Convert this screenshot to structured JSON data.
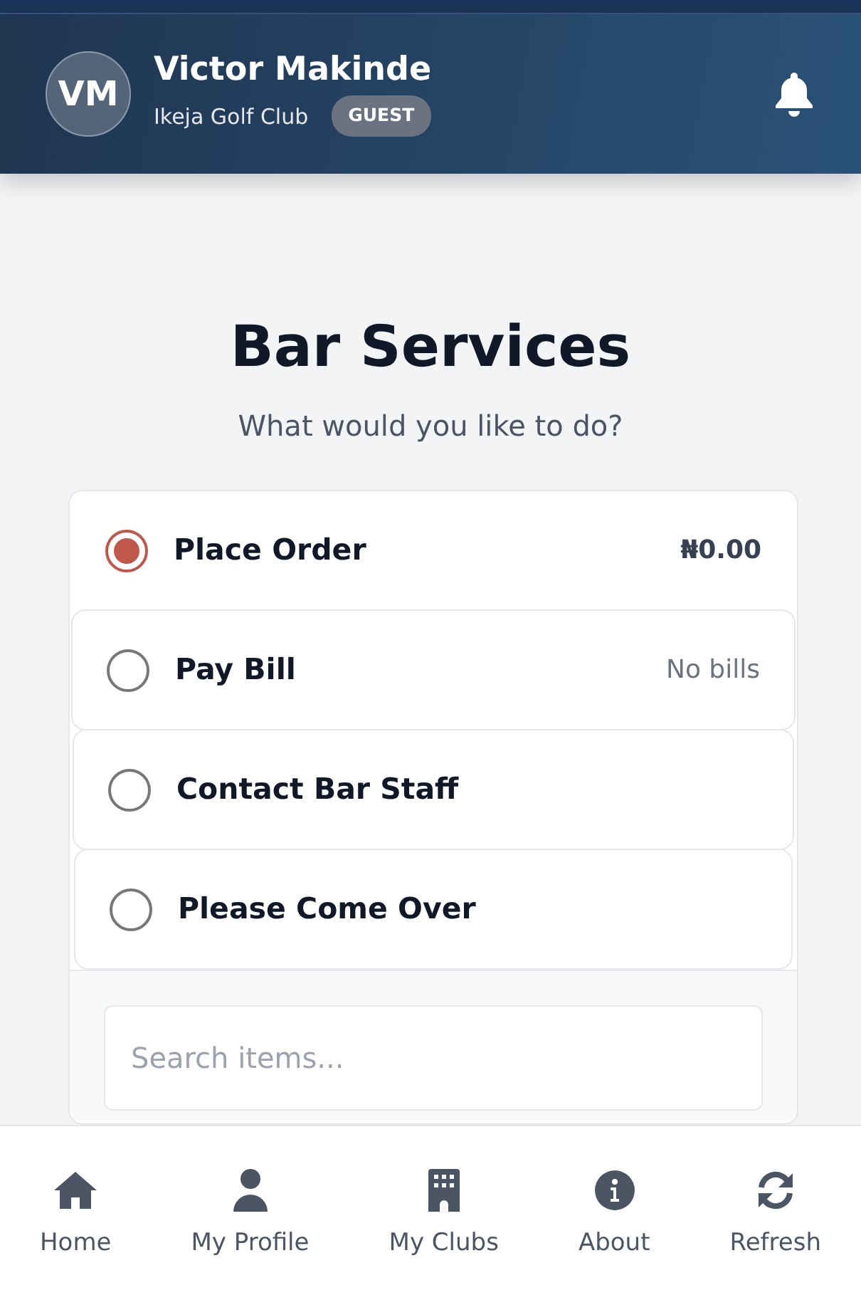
{
  "header": {
    "avatar_initials": "VM",
    "name": "Victor Makinde",
    "club": "Ikeja Golf Club",
    "role_badge": "GUEST"
  },
  "page": {
    "title": "Bar Services",
    "subtitle": "What would you like to do?"
  },
  "options": [
    {
      "label": "Place Order",
      "note": "₦0.00",
      "selected": true
    },
    {
      "label": "Pay Bill",
      "note": "No bills",
      "selected": false
    },
    {
      "label": "Contact Bar Staff",
      "selected": false
    },
    {
      "label": "Please Come Over",
      "selected": false
    }
  ],
  "search": {
    "placeholder": "Search items..."
  },
  "bottom_nav": [
    {
      "kind": "home",
      "label": "Home"
    },
    {
      "kind": "profile",
      "label": "My Profile"
    },
    {
      "kind": "clubs",
      "label": "My Clubs"
    },
    {
      "kind": "about",
      "label": "About"
    },
    {
      "kind": "refresh",
      "label": "Refresh"
    }
  ]
}
